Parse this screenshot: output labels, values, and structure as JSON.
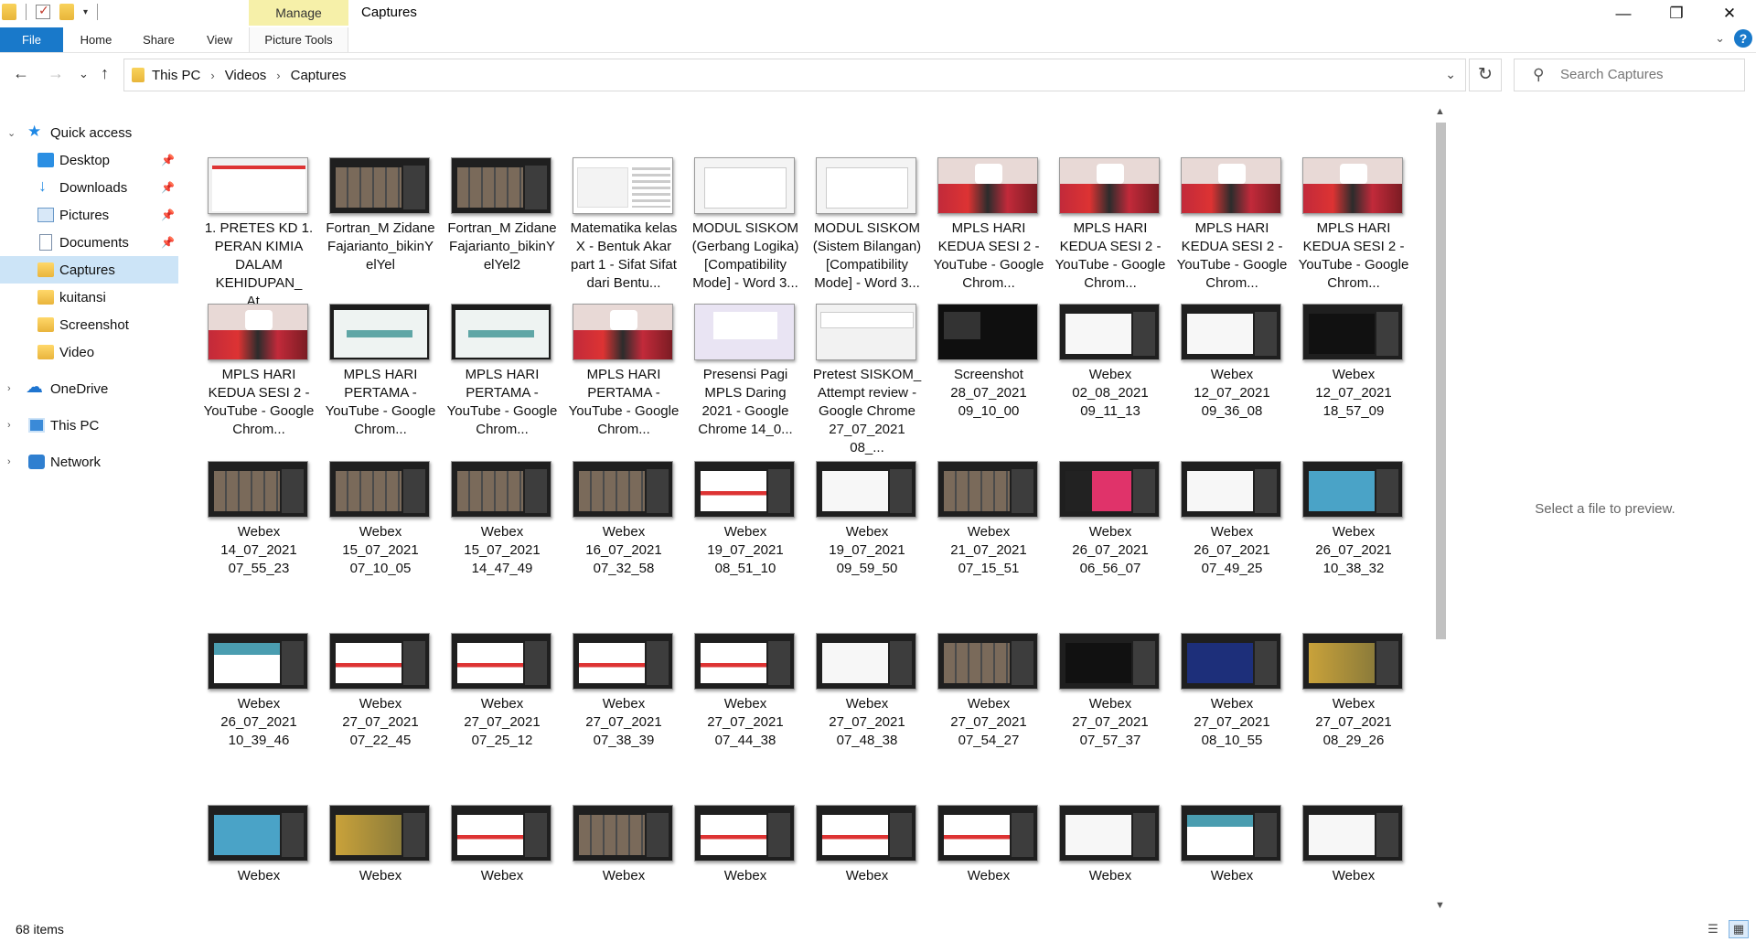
{
  "window": {
    "title": "Captures",
    "manage_tab": "Manage",
    "minimize": "—",
    "maximize": "❐",
    "close": "✕"
  },
  "ribbon": {
    "file": "File",
    "home": "Home",
    "share": "Share",
    "view": "View",
    "picture_tools": "Picture Tools",
    "expand": "⌄",
    "help": "?"
  },
  "address": {
    "back": "←",
    "forward": "→",
    "recent": "⌄",
    "up": "↑",
    "crumbs": [
      "This PC",
      "Videos",
      "Captures"
    ],
    "separator": "›",
    "dropdown": "⌄",
    "refresh": "↻"
  },
  "search": {
    "placeholder": "Search Captures",
    "icon": "⚲"
  },
  "nav": {
    "quick_access": "Quick access",
    "desktop": "Desktop",
    "downloads": "Downloads",
    "pictures": "Pictures",
    "documents": "Documents",
    "captures": "Captures",
    "kuitansi": "kuitansi",
    "screenshot": "Screenshot",
    "video": "Video",
    "onedrive": "OneDrive",
    "this_pc": "This PC",
    "network": "Network",
    "pin": "📌",
    "expanded": "⌄",
    "collapsed": "›"
  },
  "files": [
    {
      "name": "1. PRETES KD 1. PERAN KIMIA DALAM KEHIDUPAN_ At...",
      "thumb": "pretes1"
    },
    {
      "name": "Fortran_M Zidane Fajarianto_bikinYelYel",
      "thumb": "grid"
    },
    {
      "name": "Fortran_M Zidane Fajarianto_bikinYelYel2",
      "thumb": "grid"
    },
    {
      "name": "Matematika kelas X - Bentuk Akar part 1 - Sifat Sifat dari Bentu...",
      "thumb": "kelas"
    },
    {
      "name": "MODUL SISKOM (Gerbang Logika) [Compatibility Mode] - Word 3...",
      "thumb": "doc"
    },
    {
      "name": "MODUL SISKOM (Sistem Bilangan) [Compatibility Mode] - Word 3...",
      "thumb": "doc"
    },
    {
      "name": "MPLS HARI KEDUA SESI 2 - YouTube - Google Chrom...",
      "thumb": "mpls"
    },
    {
      "name": "MPLS HARI KEDUA SESI 2 - YouTube - Google Chrom...",
      "thumb": "mpls"
    },
    {
      "name": "MPLS HARI KEDUA SESI 2 - YouTube - Google Chrom...",
      "thumb": "mpls"
    },
    {
      "name": "MPLS HARI KEDUA SESI 2 - YouTube - Google Chrom...",
      "thumb": "mpls"
    },
    {
      "name": "MPLS HARI KEDUA SESI 2 - YouTube - Google Chrom...",
      "thumb": "mpls"
    },
    {
      "name": "MPLS HARI PERTAMA - YouTube - Google Chrom...",
      "thumb": "ppt"
    },
    {
      "name": "MPLS HARI PERTAMA - YouTube - Google Chrom...",
      "thumb": "ppt"
    },
    {
      "name": "MPLS HARI PERTAMA - YouTube - Google Chrom...",
      "thumb": "mpls"
    },
    {
      "name": "Presensi Pagi MPLS Daring 2021 - Google Chrome 14_0...",
      "thumb": "presensi"
    },
    {
      "name": "Pretest SISKOM_ Attempt review - Google Chrome 27_07_2021 08_...",
      "thumb": "pretest"
    },
    {
      "name": "Screenshot 28_07_2021 09_10_00",
      "thumb": "shot"
    },
    {
      "name": "Webex 02_08_2021 09_11_13",
      "thumb": "slide-white"
    },
    {
      "name": "Webex 12_07_2021 09_36_08",
      "thumb": "slide-white"
    },
    {
      "name": "Webex 12_07_2021 18_57_09",
      "thumb": "slide-dark"
    },
    {
      "name": "Webex 14_07_2021 07_55_23",
      "thumb": "grid"
    },
    {
      "name": "Webex 15_07_2021 07_10_05",
      "thumb": "grid"
    },
    {
      "name": "Webex 15_07_2021 14_47_49",
      "thumb": "grid"
    },
    {
      "name": "Webex 16_07_2021 07_32_58",
      "thumb": "grid"
    },
    {
      "name": "Webex 19_07_2021 08_51_10",
      "thumb": "slide-red"
    },
    {
      "name": "Webex 19_07_2021 09_59_50",
      "thumb": "slide-white"
    },
    {
      "name": "Webex 21_07_2021 07_15_51",
      "thumb": "grid"
    },
    {
      "name": "Webex 26_07_2021 06_56_07",
      "thumb": "slide-pink"
    },
    {
      "name": "Webex 26_07_2021 07_49_25",
      "thumb": "slide-white"
    },
    {
      "name": "Webex 26_07_2021 10_38_32",
      "thumb": "slide-teal"
    },
    {
      "name": "Webex 26_07_2021 10_39_46",
      "thumb": "slide-teal2"
    },
    {
      "name": "Webex 27_07_2021 07_22_45",
      "thumb": "slide-red"
    },
    {
      "name": "Webex 27_07_2021 07_25_12",
      "thumb": "slide-red"
    },
    {
      "name": "Webex 27_07_2021 07_38_39",
      "thumb": "slide-red"
    },
    {
      "name": "Webex 27_07_2021 07_44_38",
      "thumb": "slide-red"
    },
    {
      "name": "Webex 27_07_2021 07_48_38",
      "thumb": "slide-white"
    },
    {
      "name": "Webex 27_07_2021 07_54_27",
      "thumb": "grid"
    },
    {
      "name": "Webex 27_07_2021 07_57_37",
      "thumb": "slide-dark"
    },
    {
      "name": "Webex 27_07_2021 08_10_55",
      "thumb": "slide-navy"
    },
    {
      "name": "Webex 27_07_2021 08_29_26",
      "thumb": "slide-yellow"
    },
    {
      "name": "Webex",
      "thumb": "slide-teal"
    },
    {
      "name": "Webex",
      "thumb": "slide-yellow"
    },
    {
      "name": "Webex",
      "thumb": "slide-red"
    },
    {
      "name": "Webex",
      "thumb": "grid"
    },
    {
      "name": "Webex",
      "thumb": "slide-red"
    },
    {
      "name": "Webex",
      "thumb": "slide-red"
    },
    {
      "name": "Webex",
      "thumb": "slide-red"
    },
    {
      "name": "Webex",
      "thumb": "slide-white"
    },
    {
      "name": "Webex",
      "thumb": "slide-teal2"
    },
    {
      "name": "Webex",
      "thumb": "slide-white"
    }
  ],
  "scroll": {
    "up": "▲",
    "down": "▼"
  },
  "preview": {
    "text": "Select a file to preview."
  },
  "status": {
    "count": "68 items",
    "details_view": "☰",
    "thumb_view": "▦"
  }
}
